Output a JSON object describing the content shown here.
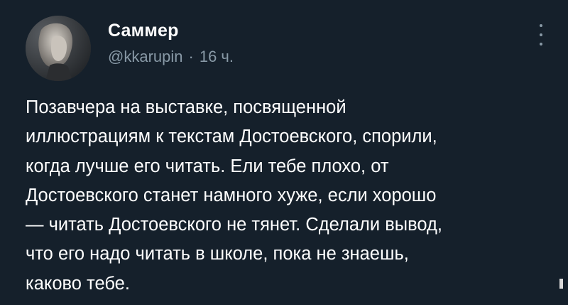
{
  "user": {
    "display_name": "Саммер",
    "handle": "@kkarupin",
    "separator": "·",
    "time": "16 ч."
  },
  "avatar_icon": "avatar-photo",
  "more_icon": "vertical-ellipsis-icon",
  "tweet": {
    "lines": [
      "Позавчера на выставке, посвященной",
      "иллюстрациям к текстам Достоевского, спорили,",
      "когда лучше его читать. Ели тебе плохо, от",
      "Достоевского станет намного хуже, если хорошо",
      "— читать Достоевского не тянет. Сделали вывод,",
      "что его надо читать в школе, пока не знаешь,",
      "каково тебе."
    ]
  },
  "colors": {
    "background": "#15202b",
    "primary_text": "#ffffff",
    "secondary_text": "#8899a6"
  }
}
